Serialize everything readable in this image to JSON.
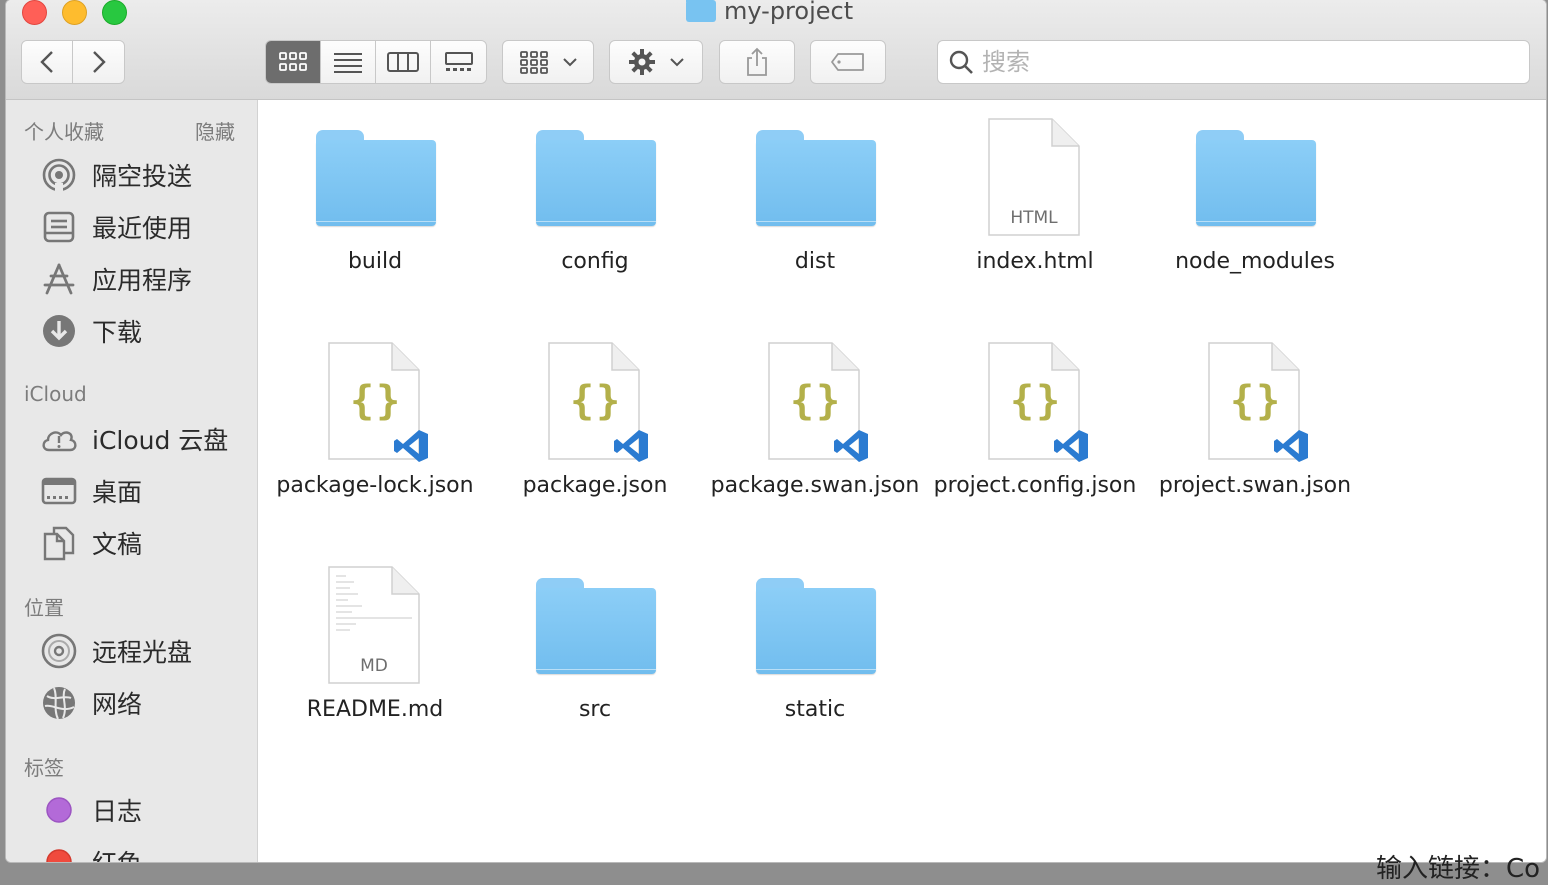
{
  "window": {
    "title": "my-project"
  },
  "search": {
    "placeholder": "搜索"
  },
  "sidebar": {
    "favorites": {
      "header": "个人收藏",
      "hide_label": "隐藏",
      "items": [
        {
          "label": "隔空投送",
          "icon": "airdrop-icon"
        },
        {
          "label": "最近使用",
          "icon": "recents-icon"
        },
        {
          "label": "应用程序",
          "icon": "applications-icon"
        },
        {
          "label": "下载",
          "icon": "downloads-icon"
        }
      ]
    },
    "icloud": {
      "header": "iCloud",
      "items": [
        {
          "label": "iCloud 云盘",
          "icon": "icloud-drive-icon"
        },
        {
          "label": "桌面",
          "icon": "desktop-icon"
        },
        {
          "label": "文稿",
          "icon": "documents-icon"
        }
      ]
    },
    "locations": {
      "header": "位置",
      "items": [
        {
          "label": "远程光盘",
          "icon": "remote-disc-icon"
        },
        {
          "label": "网络",
          "icon": "network-icon"
        }
      ]
    },
    "tags": {
      "header": "标签",
      "items": [
        {
          "label": "日志",
          "color": "#b36ad8"
        },
        {
          "label": "红色",
          "color": "#f04a3d"
        }
      ]
    }
  },
  "files": [
    {
      "name": "build",
      "kind": "folder"
    },
    {
      "name": "config",
      "kind": "folder"
    },
    {
      "name": "dist",
      "kind": "folder"
    },
    {
      "name": "index.html",
      "kind": "doc",
      "ext": "HTML"
    },
    {
      "name": "node_modules",
      "kind": "folder"
    },
    {
      "name": "package-lock.json",
      "kind": "json"
    },
    {
      "name": "package.json",
      "kind": "json"
    },
    {
      "name": "package.swan.json",
      "kind": "json"
    },
    {
      "name": "project.config.json",
      "kind": "json"
    },
    {
      "name": "project.swan.json",
      "kind": "json"
    },
    {
      "name": "README.md",
      "kind": "doc",
      "ext": "MD"
    },
    {
      "name": "src",
      "kind": "folder"
    },
    {
      "name": "static",
      "kind": "folder"
    }
  ],
  "background": {
    "fragment_right": "输入链接：Co"
  },
  "colors": {
    "folder": "#78c3f1",
    "json_braces": "#b3b04a",
    "vscode": "#2b7bd1"
  }
}
